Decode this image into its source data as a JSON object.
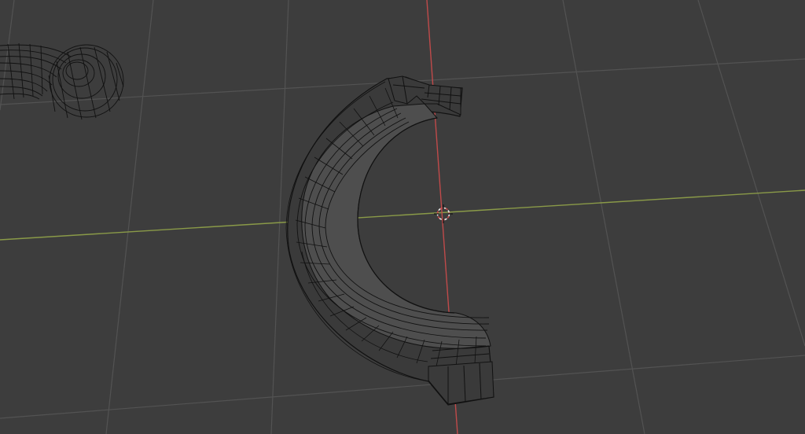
{
  "viewport": {
    "background": "#3d3d3d",
    "grid_color": "#535353",
    "x_axis_color": "#8a9a48",
    "y_axis_color": "#c04a4a",
    "wire_color": "#111111",
    "face_color": "#4e4e4e",
    "cursor_color": "#e8e8e8"
  },
  "scene": {
    "objects": [
      {
        "id": "c-shaped-mesh",
        "display": "wireframe+solid"
      },
      {
        "id": "ring-handle-mesh",
        "display": "wireframe"
      }
    ],
    "has_3d_cursor": true
  }
}
